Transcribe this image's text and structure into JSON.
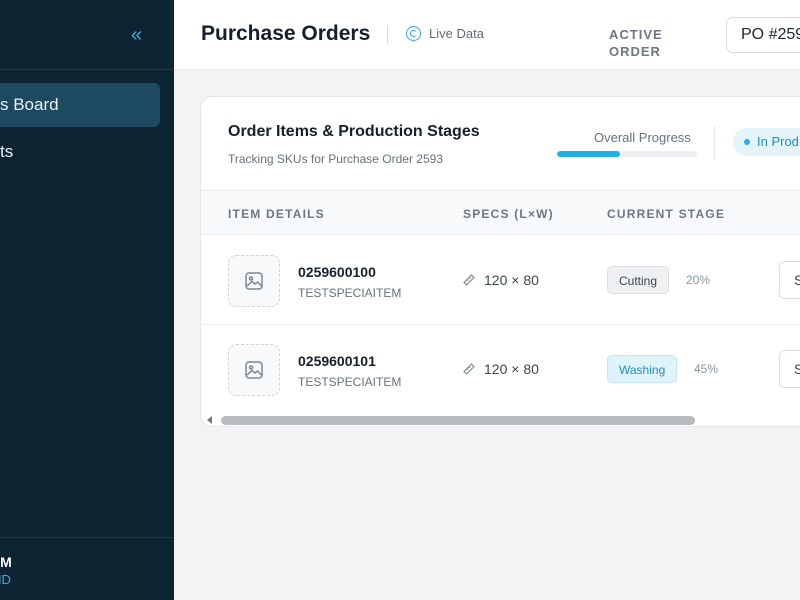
{
  "sidebar": {
    "collapse_icon": "«",
    "nav": [
      {
        "label": "s Board",
        "active": true
      },
      {
        "label": "ts",
        "active": false
      }
    ],
    "footer": {
      "name": "AM",
      "id": "r ID"
    }
  },
  "header": {
    "title": "Purchase Orders",
    "live_label": "Live Data",
    "active_order_label": "ACTIVE ORDER",
    "po_value": "PO #259"
  },
  "card": {
    "title": "Order Items & Production Stages",
    "subtitle": "Tracking SKUs for Purchase Order 2593",
    "progress_label": "Overall Progress",
    "progress_value": 0.45,
    "status": "In Prod",
    "columns": [
      "ITEM DETAILS",
      "SPECS (L×W)",
      "CURRENT STAGE"
    ],
    "rows": [
      {
        "sku": "0259600100",
        "name": "TESTSPECIAITEM",
        "spec": "120 × 80",
        "stage": "Cutting",
        "percent": "20%",
        "action": "S"
      },
      {
        "sku": "0259600101",
        "name": "TESTSPECIAITEM",
        "spec": "120 × 80",
        "stage": "Washing",
        "percent": "45%",
        "action": "S"
      }
    ]
  },
  "colors": {
    "sidebar_bg": "#0d2533",
    "accent": "#1fb1e6",
    "active_nav": "#1d4a60"
  },
  "icons": {
    "collapse": "double-chevron-left-icon",
    "live": "refresh-icon",
    "thumb": "image-placeholder-icon",
    "spec": "ruler-icon"
  }
}
